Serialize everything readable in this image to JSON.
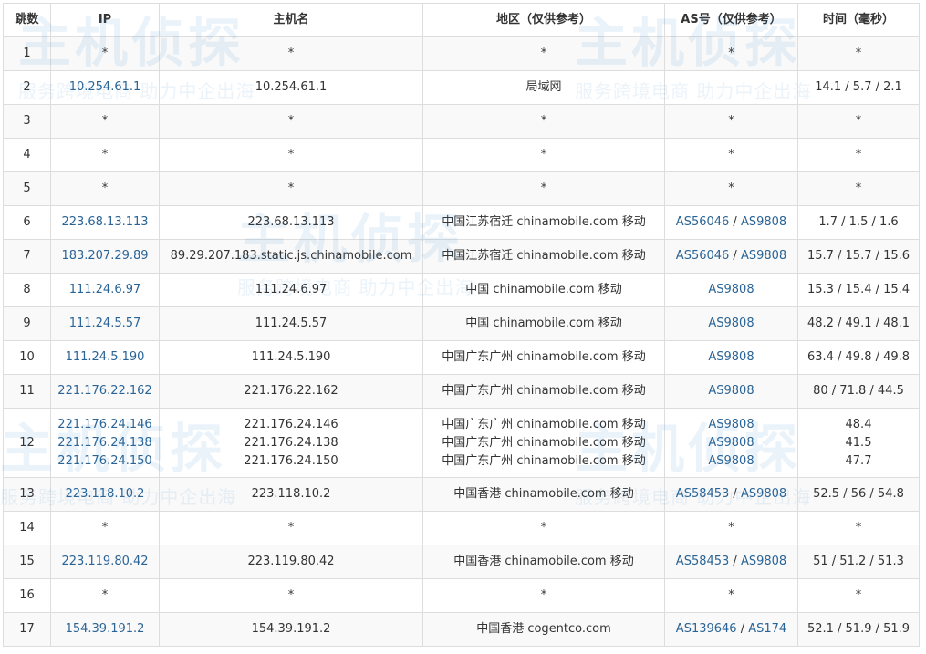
{
  "headers": {
    "hop": "跳数",
    "ip": "IP",
    "host": "主机名",
    "region": "地区（仅供参考）",
    "asn": "AS号（仅供参考）",
    "time": "时间（毫秒）"
  },
  "rows": [
    {
      "hop": "1",
      "ip": "*",
      "host": "*",
      "region": "*",
      "asn": "*",
      "time": "*"
    },
    {
      "hop": "2",
      "ip": "10.254.61.1",
      "host": "10.254.61.1",
      "region": "局域网",
      "asn": "",
      "time": "14.1 / 5.7 / 2.1"
    },
    {
      "hop": "3",
      "ip": "*",
      "host": "*",
      "region": "*",
      "asn": "*",
      "time": "*"
    },
    {
      "hop": "4",
      "ip": "*",
      "host": "*",
      "region": "*",
      "asn": "*",
      "time": "*"
    },
    {
      "hop": "5",
      "ip": "*",
      "host": "*",
      "region": "*",
      "asn": "*",
      "time": "*"
    },
    {
      "hop": "6",
      "ip": "223.68.13.113",
      "host": "223.68.13.113",
      "region": "中国江苏宿迁 chinamobile.com 移动",
      "asn1": "AS56046",
      "asn_sep": " / ",
      "asn2": "AS9808",
      "time": "1.7 / 1.5 / 1.6"
    },
    {
      "hop": "7",
      "ip": "183.207.29.89",
      "host": "89.29.207.183.static.js.chinamobile.com",
      "region": "中国江苏宿迁 chinamobile.com 移动",
      "asn1": "AS56046",
      "asn_sep": " / ",
      "asn2": "AS9808",
      "time": "15.7 / 15.7 / 15.6"
    },
    {
      "hop": "8",
      "ip": "111.24.6.97",
      "host": "111.24.6.97",
      "region": "中国 chinamobile.com 移动",
      "asn": "AS9808",
      "time": "15.3 / 15.4 / 15.4"
    },
    {
      "hop": "9",
      "ip": "111.24.5.57",
      "host": "111.24.5.57",
      "region": "中国 chinamobile.com 移动",
      "asn": "AS9808",
      "time": "48.2 / 49.1 / 48.1"
    },
    {
      "hop": "10",
      "ip": "111.24.5.190",
      "host": "111.24.5.190",
      "region": "中国广东广州 chinamobile.com 移动",
      "asn": "AS9808",
      "time": "63.4 / 49.8 / 49.8"
    },
    {
      "hop": "11",
      "ip": "221.176.22.162",
      "host": "221.176.22.162",
      "region": "中国广东广州 chinamobile.com 移动",
      "asn": "AS9808",
      "time": "80 / 71.8 / 44.5"
    },
    {
      "hop": "12",
      "ips": [
        "221.176.24.146",
        "221.176.24.138",
        "221.176.24.150"
      ],
      "hosts": [
        "221.176.24.146",
        "221.176.24.138",
        "221.176.24.150"
      ],
      "regions": [
        "中国广东广州 chinamobile.com 移动",
        "中国广东广州 chinamobile.com 移动",
        "中国广东广州 chinamobile.com 移动"
      ],
      "asns": [
        "AS9808",
        "AS9808",
        "AS9808"
      ],
      "times": [
        "48.4",
        "41.5",
        "47.7"
      ]
    },
    {
      "hop": "13",
      "ip": "223.118.10.2",
      "host": "223.118.10.2",
      "region": "中国香港 chinamobile.com 移动",
      "asn1": "AS58453",
      "asn_sep": " / ",
      "asn2": "AS9808",
      "time": "52.5 / 56 / 54.8"
    },
    {
      "hop": "14",
      "ip": "*",
      "host": "*",
      "region": "*",
      "asn": "*",
      "time": "*"
    },
    {
      "hop": "15",
      "ip": "223.119.80.42",
      "host": "223.119.80.42",
      "region": "中国香港 chinamobile.com 移动",
      "asn1": "AS58453",
      "asn_sep": " / ",
      "asn2": "AS9808",
      "time": "51 / 51.2 / 51.3"
    },
    {
      "hop": "16",
      "ip": "*",
      "host": "*",
      "region": "*",
      "asn": "*",
      "time": "*"
    },
    {
      "hop": "17",
      "ip": "154.39.191.2",
      "host": "154.39.191.2",
      "region": "中国香港 cogentco.com",
      "asn1": "AS139646",
      "asn_sep": " / ",
      "asn2": "AS174",
      "time": "52.1 / 51.9 / 51.9"
    }
  ],
  "watermark": {
    "logo": "主机侦探",
    "slogan": "服务跨境电商 助力中企出海"
  },
  "colors": {
    "link": "#2a6496",
    "border": "#dddddd",
    "stripe": "#f9f9f9",
    "text": "#333333",
    "watermark": "#3c8ccd"
  }
}
